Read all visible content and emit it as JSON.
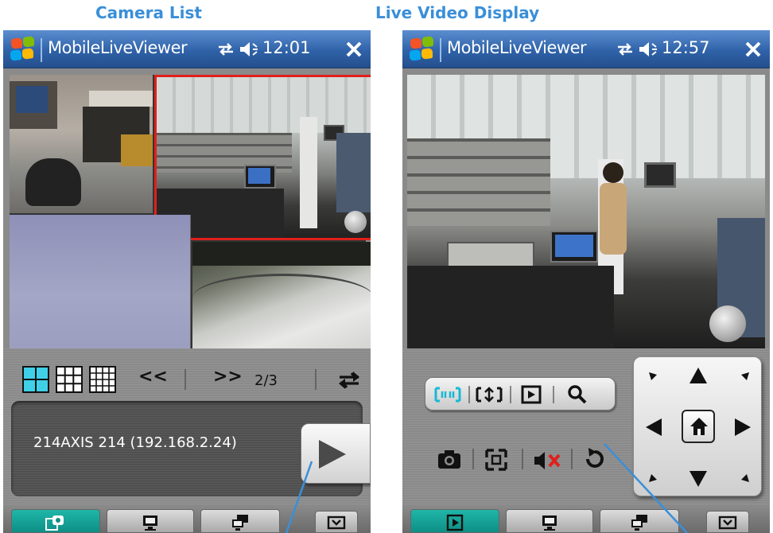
{
  "captions": {
    "left": "Camera List",
    "right": "Live Video Display"
  },
  "screens": {
    "left": {
      "title": "MobileLiveViewer",
      "time": "12:01",
      "paging": {
        "prev": "<<",
        "next": ">>",
        "page": "2/3"
      },
      "selected_camera": "214AXIS 214 (192.168.2.24)"
    },
    "right": {
      "title": "MobileLiveViewer",
      "time": "12:57"
    }
  },
  "icons": {
    "layout_2x2": "layout-2x2-icon",
    "layout_3x3": "layout-3x3-icon",
    "layout_4x4": "layout-4x4-icon",
    "cycle": "cycle-icon",
    "play": "play-icon",
    "snapshot": "camera-icon",
    "fullscreen": "fullscreen-icon",
    "mute": "mute-icon",
    "refresh": "refresh-icon",
    "home": "home-icon"
  },
  "colors": {
    "caption": "#3a8fd8",
    "titlebar": "#2f62a8",
    "selected_border": "#e0201c",
    "active_tab": "#1fb6a8",
    "callout_line": "#3a8fd8"
  }
}
